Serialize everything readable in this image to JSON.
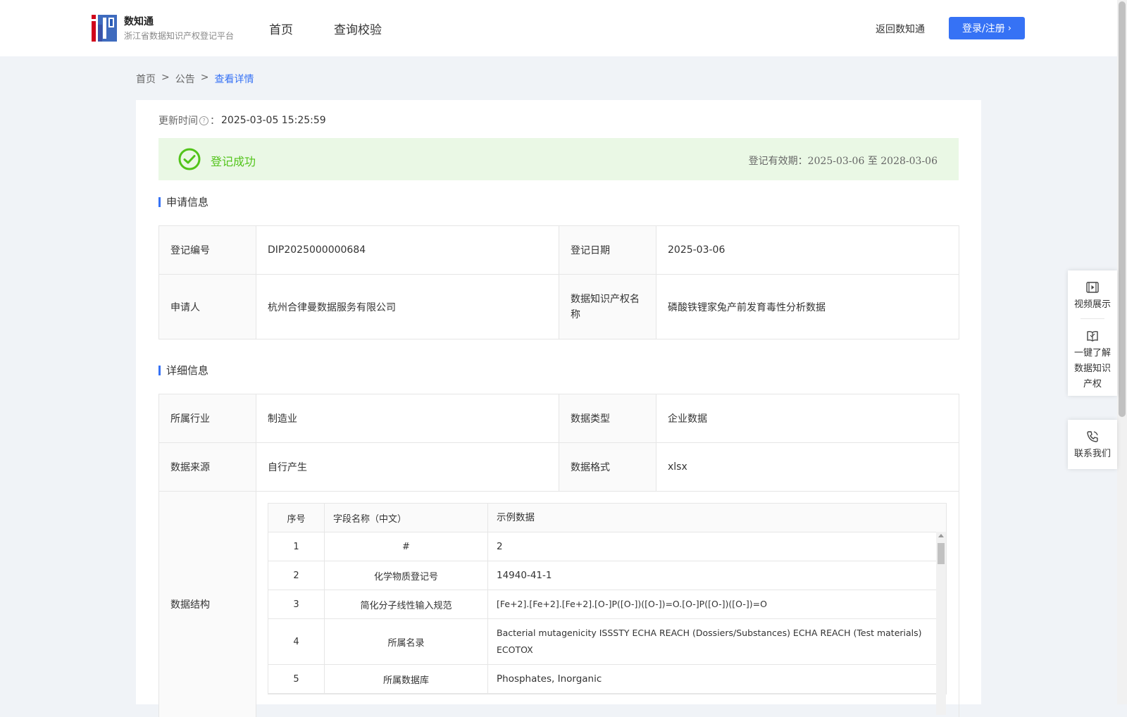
{
  "header": {
    "brand_name": "数知通",
    "brand_sub": "浙江省数据知识产权登记平台",
    "nav": [
      "首页",
      "查询校验"
    ],
    "back_link": "返回数知通",
    "login": "登录/注册"
  },
  "breadcrumb": [
    "首页",
    ">",
    "公告",
    ">",
    "查看详情"
  ],
  "update": {
    "label": "更新时间",
    "sep": "：",
    "value": "2025-03-05 15:25:59"
  },
  "status": {
    "text": "登记成功",
    "validity": "登记有效期：2025-03-06 至 2028-03-06",
    "color": "#52c41a"
  },
  "sections": {
    "apply": "申请信息",
    "detail": "详细信息"
  },
  "apply": [
    [
      {
        "k": "登记编号",
        "v": "DIP2025000000684"
      },
      {
        "k": "登记日期",
        "v": "2025-03-06"
      }
    ],
    [
      {
        "k": "申请人",
        "v": "杭州合律曼数据服务有限公司"
      },
      {
        "k": "数据知识产权名称",
        "v": "磷酸铁锂家兔产前发育毒性分析数据"
      }
    ]
  ],
  "detail": [
    [
      {
        "k": "所属行业",
        "v": "制造业"
      },
      {
        "k": "数据类型",
        "v": "企业数据"
      }
    ],
    [
      {
        "k": "数据来源",
        "v": "自行产生"
      },
      {
        "k": "数据格式",
        "v": "xlsx"
      }
    ]
  ],
  "structure": {
    "label": "数据结构",
    "headers": [
      "序号",
      "字段名称（中文）",
      "示例数据"
    ],
    "rows": [
      [
        "1",
        "#",
        "2"
      ],
      [
        "2",
        "化学物质登记号",
        "14940-41-1"
      ],
      [
        "3",
        "简化分子线性输入规范",
        "[Fe+2].[Fe+2].[Fe+2].[O-]P([O-])([O-])=O.[O-]P([O-])([O-])=O"
      ],
      [
        "4",
        "所属名录",
        "Bacterial mutagenicity ISSSTY ECHA REACH (Dossiers/Substances) ECHA REACH (Test materials) ECOTOX"
      ],
      [
        "5",
        "所属数据库",
        "Phosphates, Inorganic"
      ]
    ]
  },
  "float": {
    "video": "视频展示",
    "learn": "一键了解数据知识产权",
    "contact": "联系我们"
  },
  "colors": {
    "accent": "#3672f5"
  }
}
